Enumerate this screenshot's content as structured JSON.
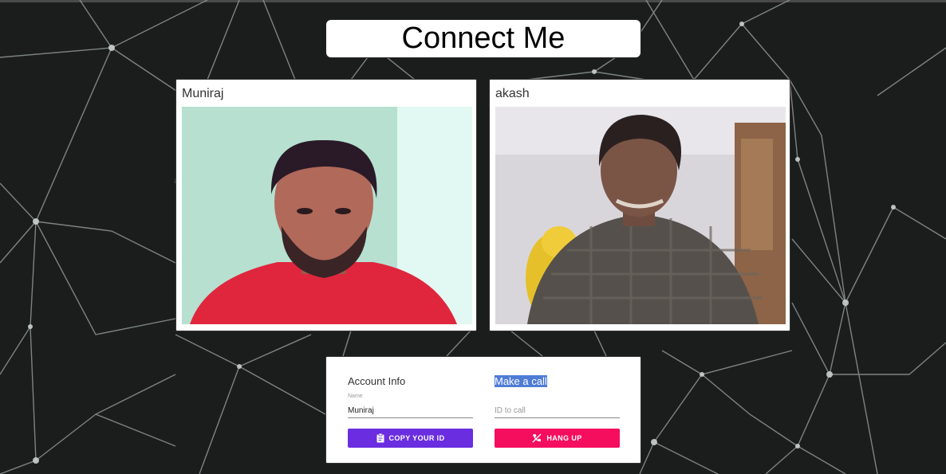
{
  "app": {
    "title": "Connect Me"
  },
  "videos": [
    {
      "name": "Muniraj"
    },
    {
      "name": "akash"
    }
  ],
  "account": {
    "heading": "Account Info",
    "name_label": "Name",
    "name_value": "Muniraj",
    "copy_label": "COPY YOUR ID"
  },
  "call": {
    "heading": "Make a call",
    "id_placeholder": "ID to call",
    "hangup_label": "HANG UP"
  },
  "colors": {
    "copy_button": "#6a2de0",
    "hangup_button": "#f50d5e",
    "selection": "#4f7cd6",
    "background": "#1b1d1d"
  },
  "icons": [
    "clipboard-icon",
    "phone-disabled-icon"
  ]
}
